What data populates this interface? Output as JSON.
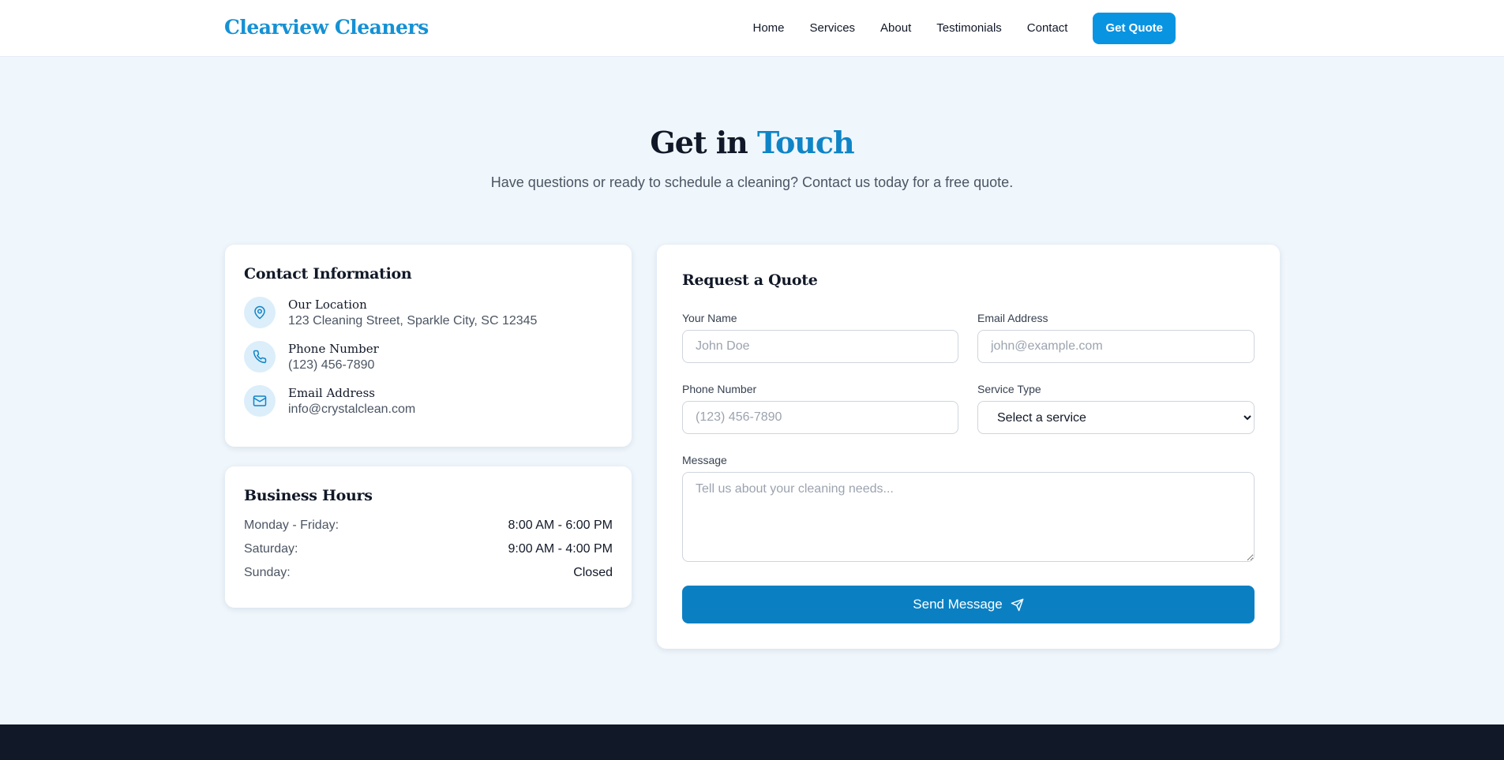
{
  "header": {
    "brand": "Clearview Cleaners",
    "nav": [
      {
        "label": "Home"
      },
      {
        "label": "Services"
      },
      {
        "label": "About"
      },
      {
        "label": "Testimonials"
      },
      {
        "label": "Contact"
      }
    ],
    "cta_label": "Get Quote"
  },
  "hero": {
    "title_plain": "Get in",
    "title_accent": "Touch",
    "subtitle": "Have questions or ready to schedule a cleaning? Contact us today for a free quote."
  },
  "contact_info": {
    "title": "Contact Information",
    "items": [
      {
        "icon": "map-pin-icon",
        "label": "Our Location",
        "value": "123 Cleaning Street, Sparkle City, SC 12345"
      },
      {
        "icon": "phone-icon",
        "label": "Phone Number",
        "value": "(123) 456-7890"
      },
      {
        "icon": "mail-icon",
        "label": "Email Address",
        "value": "info@crystalclean.com"
      }
    ]
  },
  "business_hours": {
    "title": "Business Hours",
    "rows": [
      {
        "day": "Monday - Friday:",
        "time": "8:00 AM - 6:00 PM"
      },
      {
        "day": "Saturday:",
        "time": "9:00 AM - 4:00 PM"
      },
      {
        "day": "Sunday:",
        "time": "Closed"
      }
    ]
  },
  "quote_form": {
    "title": "Request a Quote",
    "name": {
      "label": "Your Name",
      "placeholder": "John Doe",
      "value": ""
    },
    "email": {
      "label": "Email Address",
      "placeholder": "john@example.com",
      "value": ""
    },
    "phone": {
      "label": "Phone Number",
      "placeholder": "(123) 456-7890",
      "value": ""
    },
    "service": {
      "label": "Service Type",
      "selected": "Select a service"
    },
    "message": {
      "label": "Message",
      "placeholder": "Tell us about your cleaning needs...",
      "value": ""
    },
    "submit_label": "Send Message"
  },
  "colors": {
    "accent": "#0994e2",
    "brand": "#1591d4",
    "button": "#0a80c3",
    "page_background": "#eff6fc",
    "footer": "#111827"
  }
}
